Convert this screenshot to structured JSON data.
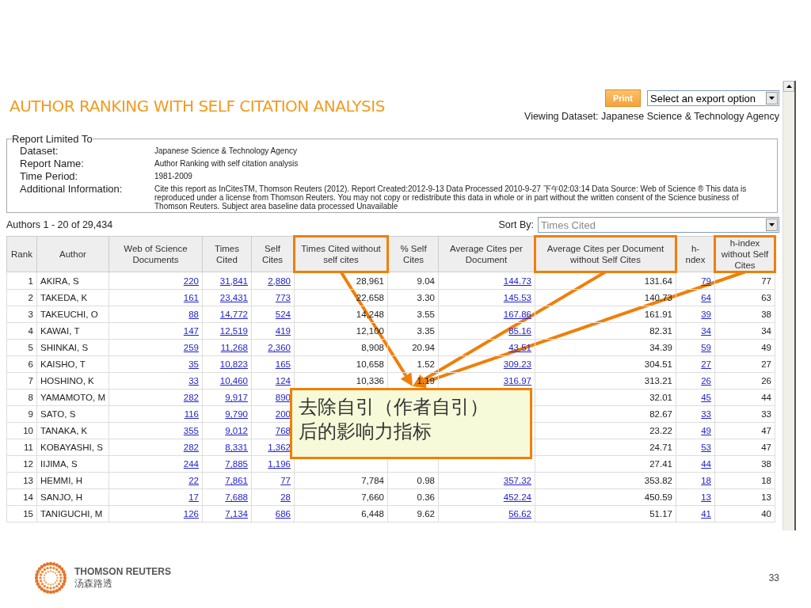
{
  "report": {
    "title": "AUTHOR RANKING WITH SELF CITATION ANALYSIS",
    "print_button": "Print",
    "export_select": {
      "value": "Select an export option"
    },
    "viewing_dataset": "Viewing Dataset: Japanese Science & Technology Agency",
    "limits": {
      "legend": "Report Limited To",
      "fields": [
        {
          "label": "Dataset:",
          "value": "Japanese Science & Technology Agency"
        },
        {
          "label": "Report Name:",
          "value": "Author Ranking with self citation analysis"
        },
        {
          "label": "Time Period:",
          "value": "1981-2009"
        },
        {
          "label": "Additional Information:",
          "value": "Cite this report as InCitesTM, Thomson Reuters (2012). Report Created:2012-9-13  Data Processed 2010-9-27 下午02:03:14  Data Source: Web of Science ® This data is reproduced under a license from Thomson Reuters. You may not copy or redistribute this data in whole or in part without the written consent of the Science business of Thomson Reuters. Subject area baseline data processed Unavailable"
        }
      ]
    },
    "count": "Authors 1 - 20  of  29,434",
    "sort": {
      "label": "Sort By:",
      "value": "Times Cited"
    },
    "table": {
      "columns": [
        {
          "label": "Rank",
          "kind": "number",
          "highlighted": false
        },
        {
          "label": "Author",
          "kind": "text",
          "highlighted": false
        },
        {
          "label": "Web of Science Documents",
          "kind": "link",
          "highlighted": false
        },
        {
          "label": "Times Cited",
          "kind": "link",
          "highlighted": false
        },
        {
          "label": "Self Cites",
          "kind": "link",
          "highlighted": false
        },
        {
          "label": "Times Cited without self cites",
          "kind": "number",
          "highlighted": true
        },
        {
          "label": "% Self Cites",
          "kind": "number",
          "highlighted": false
        },
        {
          "label": "Average Cites per Document",
          "kind": "link",
          "highlighted": false
        },
        {
          "label": "Average Cites per Document without Self Cites",
          "kind": "number",
          "highlighted": true
        },
        {
          "label": "h- ndex",
          "kind": "link",
          "highlighted": false
        },
        {
          "label": "h-index without Self Cites",
          "kind": "number",
          "highlighted": true
        }
      ],
      "rows": [
        {
          "cells": [
            "1",
            "AKIRA, S",
            "220",
            "31,841",
            "2,880",
            "28,961",
            "9.04",
            "144.73",
            "131.64",
            "79",
            "77"
          ]
        },
        {
          "cells": [
            "2",
            "TAKEDA, K",
            "161",
            "23,431",
            "773",
            "22,658",
            "3.30",
            "145.53",
            "140.73",
            "64",
            "63"
          ]
        },
        {
          "cells": [
            "3",
            "TAKEUCHI, O",
            "88",
            "14,772",
            "524",
            "14,248",
            "3.55",
            "167.86",
            "161.91",
            "39",
            "38"
          ]
        },
        {
          "cells": [
            "4",
            "KAWAI, T",
            "147",
            "12,519",
            "419",
            "12,100",
            "3.35",
            "85.16",
            "82.31",
            "34",
            "34"
          ]
        },
        {
          "cells": [
            "5",
            "SHINKAI, S",
            "259",
            "11,268",
            "2,360",
            "8,908",
            "20.94",
            "43.51",
            "34.39",
            "59",
            "49"
          ]
        },
        {
          "cells": [
            "6",
            "KAISHO, T",
            "35",
            "10,823",
            "165",
            "10,658",
            "1.52",
            "309.23",
            "304.51",
            "27",
            "27"
          ]
        },
        {
          "cells": [
            "7",
            "HOSHINO, K",
            "33",
            "10,460",
            "124",
            "10,336",
            "1.19",
            "316.97",
            "313.21",
            "26",
            "26"
          ]
        },
        {
          "cells": [
            "8",
            "YAMAMOTO, M",
            "282",
            "9,917",
            "890",
            null,
            null,
            null,
            "32.01",
            "45",
            "44"
          ]
        },
        {
          "cells": [
            "9",
            "SATO, S",
            "116",
            "9,790",
            "200",
            null,
            null,
            null,
            "82.67",
            "33",
            "33"
          ]
        },
        {
          "cells": [
            "10",
            "TANAKA, K",
            "355",
            "9,012",
            "768",
            null,
            null,
            null,
            "23.22",
            "49",
            "47"
          ]
        },
        {
          "cells": [
            "11",
            "KOBAYASHI, S",
            "282",
            "8,331",
            "1,362",
            null,
            null,
            null,
            "24.71",
            "53",
            "47"
          ]
        },
        {
          "cells": [
            "12",
            "IIJIMA, S",
            "244",
            "7,885",
            "1,196",
            null,
            null,
            null,
            "27.41",
            "44",
            "38"
          ]
        },
        {
          "cells": [
            "13",
            "HEMMI, H",
            "22",
            "7,861",
            "77",
            "7,784",
            "0.98",
            "357.32",
            "353.82",
            "18",
            "18"
          ]
        },
        {
          "cells": [
            "14",
            "SANJO, H",
            "17",
            "7,688",
            "28",
            "7,660",
            "0.36",
            "452.24",
            "450.59",
            "13",
            "13"
          ]
        },
        {
          "cells": [
            "15",
            "TANIGUCHI, M",
            "126",
            "7,134",
            "686",
            "6,448",
            "9.62",
            "56.62",
            "51.17",
            "41",
            "40"
          ]
        }
      ]
    },
    "callout": {
      "lines": [
        "去除自引（作者自引）",
        "后的影响力指标"
      ]
    }
  },
  "slide": {
    "logo": {
      "name": "THOMSON REUTERS",
      "name_local": "汤森路透"
    },
    "page_number": "33"
  }
}
